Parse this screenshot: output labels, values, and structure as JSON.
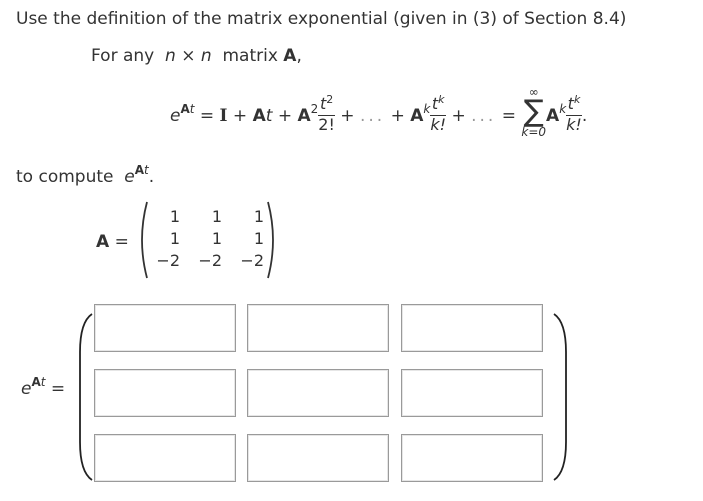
{
  "instruction": {
    "line1": "Use the definition of the matrix exponential (given in (3) of Section 8.4)",
    "for_any": "For any",
    "n1": "n",
    "times": "×",
    "n2": "n",
    "matrix_word": "matrix",
    "A": "A",
    "comma": ",",
    "to_compute": "to compute",
    "period": "."
  },
  "definition": {
    "e": "e",
    "At": "A",
    "t": "t",
    "eq": "=",
    "I": "I",
    "plus": "+",
    "A": "A",
    "sq": "2",
    "t2_num": "t",
    "k": "k",
    "fact2": "2!",
    "factk": "k!",
    "dots": "...",
    "sum_upper": "∞",
    "sum_sym": "∑",
    "sum_lower": "k=0",
    "end": "."
  },
  "matrix_A": {
    "label": "A",
    "eq": "=",
    "rows": [
      [
        "1",
        "1",
        "1"
      ],
      [
        "1",
        "1",
        "1"
      ],
      [
        "−2",
        "−2",
        "−2"
      ]
    ]
  },
  "answer": {
    "label_e": "e",
    "label_A": "A",
    "label_t": "t",
    "eq": "=",
    "cells": [
      [
        "",
        "",
        ""
      ],
      [
        "",
        "",
        ""
      ],
      [
        "",
        "",
        ""
      ]
    ]
  }
}
